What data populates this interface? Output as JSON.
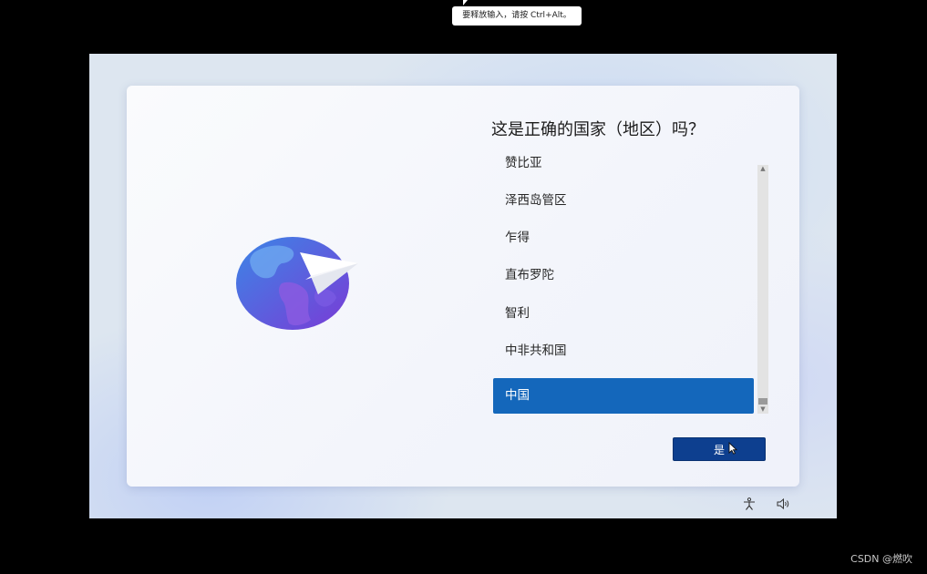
{
  "vm_hint": {
    "text": "要释放输入，请按 Ctrl+Alt。"
  },
  "oobe": {
    "title": "这是正确的国家（地区）吗？",
    "countries": [
      {
        "label": "赞比亚",
        "selected": false
      },
      {
        "label": "泽西岛管区",
        "selected": false
      },
      {
        "label": "乍得",
        "selected": false
      },
      {
        "label": "直布罗陀",
        "selected": false
      },
      {
        "label": "智利",
        "selected": false
      },
      {
        "label": "中非共和国",
        "selected": false
      },
      {
        "label": "中国",
        "selected": true
      }
    ],
    "yes_button": "是"
  },
  "tray": {
    "accessibility_icon": "accessibility-icon",
    "volume_icon": "volume-icon"
  },
  "watermark": {
    "text": "CSDN @燃吹"
  },
  "colors": {
    "selected": "#1467bb",
    "button": "#0d3f8f",
    "background": "#000000",
    "card": "#f6f7fb"
  }
}
